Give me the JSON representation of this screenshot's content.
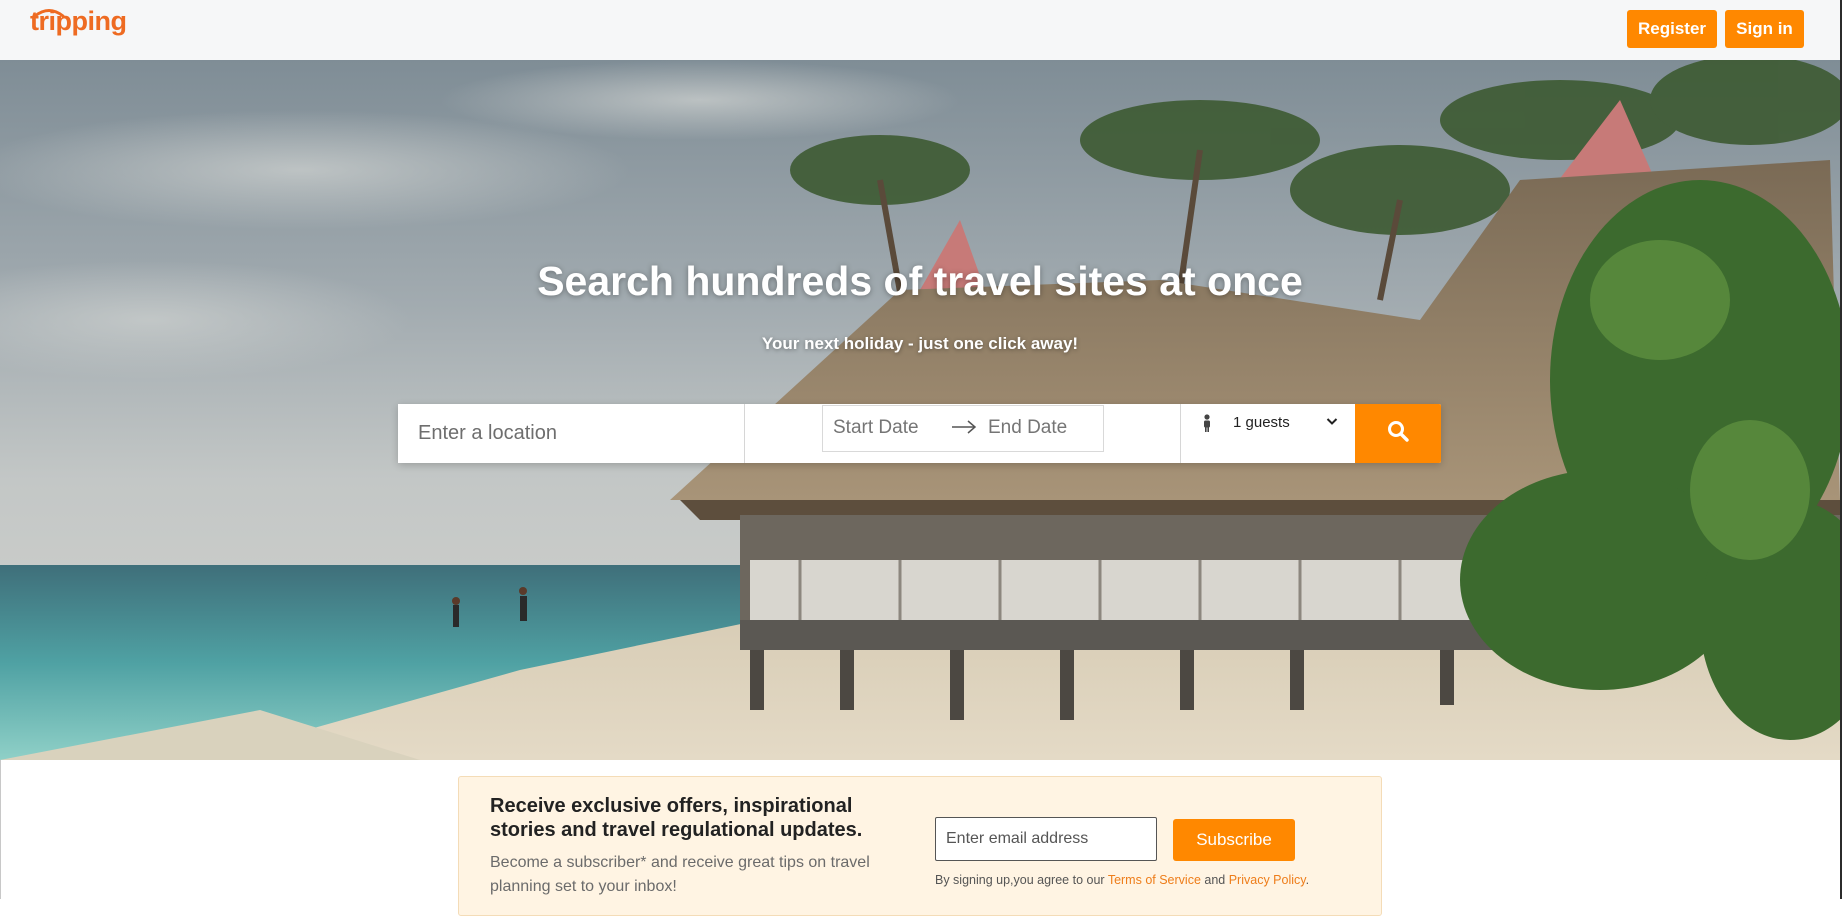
{
  "header": {
    "logo": "tripping",
    "register_label": "Register",
    "signin_label": "Sign in"
  },
  "hero": {
    "title": "Search hundreds of travel sites at once",
    "subtitle": "Your next holiday - just one click away!"
  },
  "search": {
    "location_placeholder": "Enter a location",
    "start_date_placeholder": "Start Date",
    "end_date_placeholder": "End Date",
    "guests_value": "1 guests"
  },
  "newsletter": {
    "heading": "Receive exclusive offers, inspirational stories and travel regulational updates.",
    "text": "Become a subscriber* and receive great tips on travel planning set to your inbox!",
    "email_placeholder": "Enter email address",
    "subscribe_label": "Subscribe",
    "legal_prefix": "By signing up,you agree to our ",
    "terms_label": "Terms of Service",
    "legal_and": " and ",
    "privacy_label": "Privacy Policy",
    "legal_suffix": "."
  },
  "colors": {
    "accent": "#ff8800",
    "logo": "#ee6b22",
    "newsletter_bg": "#fff4e3"
  }
}
